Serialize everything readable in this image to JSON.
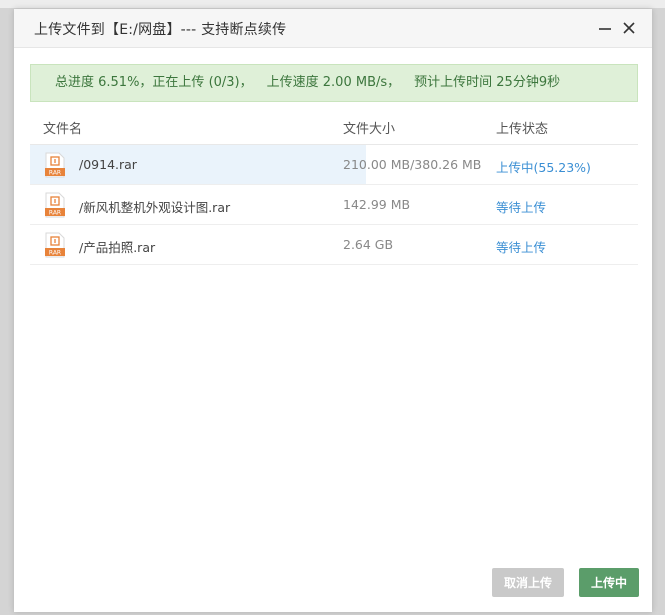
{
  "dialog": {
    "title": "上传文件到【E:/网盘】--- 支持断点续传"
  },
  "banner": {
    "total_progress": "总进度 6.51%，正在上传 (0/3)，",
    "speed": "上传速度 2.00 MB/s，",
    "eta": "预计上传时间 25分钟9秒"
  },
  "table": {
    "headers": {
      "name": "文件名",
      "size": "文件大小",
      "status": "上传状态"
    },
    "rows": [
      {
        "name": "/0914.rar",
        "size": "210.00 MB/380.26 MB",
        "status": "上传中(55.23%)",
        "progress": 0.5523,
        "icon_label": "RAR"
      },
      {
        "name": "/新风机整机外观设计图.rar",
        "size": "142.99 MB",
        "status": "等待上传",
        "progress": 0,
        "icon_label": "RAR"
      },
      {
        "name": "/产品拍照.rar",
        "size": "2.64 GB",
        "status": "等待上传",
        "progress": 0,
        "icon_label": "RAR"
      }
    ]
  },
  "buttons": {
    "cancel": "取消上传",
    "uploading": "上传中"
  },
  "colors": {
    "banner_bg": "#dff0d8",
    "banner_text": "#3c763d",
    "status_link": "#3b8fd4",
    "progress_fill": "#eaf3fb",
    "upload_button": "#5b9d6a",
    "cancel_button_disabled": "#c9c9c9",
    "rar_icon": "#e8833a"
  },
  "icons": {
    "minimize": "minimize-icon",
    "close": "close-icon",
    "file": "rar-file-icon"
  }
}
